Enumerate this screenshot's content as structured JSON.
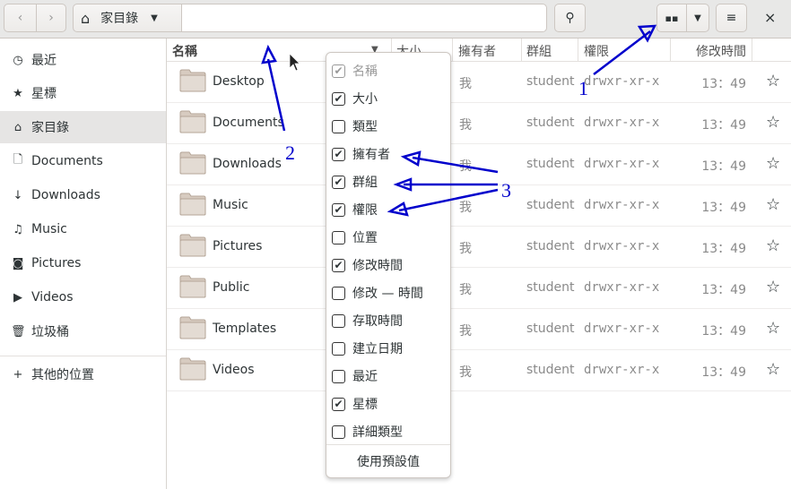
{
  "header": {
    "location": "家目錄",
    "back": "back",
    "forward": "forward"
  },
  "sidebar": {
    "items": [
      {
        "label": "最近",
        "icon": "clock-icon",
        "glyph": "◷"
      },
      {
        "label": "星標",
        "icon": "star-icon",
        "glyph": "★"
      },
      {
        "label": "家目錄",
        "icon": "home-icon",
        "glyph": "⌂",
        "selected": true
      },
      {
        "label": "Documents",
        "icon": "document-icon",
        "glyph": "🗋"
      },
      {
        "label": "Downloads",
        "icon": "download-icon",
        "glyph": "↓"
      },
      {
        "label": "Music",
        "icon": "music-icon",
        "glyph": "♫"
      },
      {
        "label": "Pictures",
        "icon": "camera-icon",
        "glyph": "◙"
      },
      {
        "label": "Videos",
        "icon": "video-icon",
        "glyph": "▶"
      },
      {
        "label": "垃圾桶",
        "icon": "trash-icon",
        "glyph": "🗑"
      },
      {
        "label": "其他的位置",
        "icon": "plus-icon",
        "glyph": "+"
      }
    ]
  },
  "columns": {
    "name": "名稱",
    "size": "大小",
    "owner": "擁有者",
    "group": "群組",
    "permissions": "權限",
    "modified": "修改時間"
  },
  "files": [
    {
      "name": "Desktop",
      "owner": "我",
      "group": "student",
      "permissions": "drwxr-xr-x",
      "modified": "13：49"
    },
    {
      "name": "Documents",
      "owner": "我",
      "group": "student",
      "permissions": "drwxr-xr-x",
      "modified": "13：49"
    },
    {
      "name": "Downloads",
      "owner": "我",
      "group": "student",
      "permissions": "drwxr-xr-x",
      "modified": "13：49"
    },
    {
      "name": "Music",
      "owner": "我",
      "group": "student",
      "permissions": "drwxr-xr-x",
      "modified": "13：49"
    },
    {
      "name": "Pictures",
      "owner": "我",
      "group": "student",
      "permissions": "drwxr-xr-x",
      "modified": "13：49"
    },
    {
      "name": "Public",
      "owner": "我",
      "group": "student",
      "permissions": "drwxr-xr-x",
      "modified": "13：49"
    },
    {
      "name": "Templates",
      "owner": "我",
      "group": "student",
      "permissions": "drwxr-xr-x",
      "modified": "13：49"
    },
    {
      "name": "Videos",
      "owner": "我",
      "group": "student",
      "permissions": "drwxr-xr-x",
      "modified": "13：49"
    }
  ],
  "popover": {
    "items": [
      {
        "label": "名稱",
        "checked": true,
        "disabled": true
      },
      {
        "label": "大小",
        "checked": true
      },
      {
        "label": "類型",
        "checked": false
      },
      {
        "label": "擁有者",
        "checked": true
      },
      {
        "label": "群組",
        "checked": true
      },
      {
        "label": "權限",
        "checked": true
      },
      {
        "label": "位置",
        "checked": false
      },
      {
        "label": "修改時間",
        "checked": true
      },
      {
        "label": "修改 — 時間",
        "checked": false
      },
      {
        "label": "存取時間",
        "checked": false
      },
      {
        "label": "建立日期",
        "checked": false
      },
      {
        "label": "最近",
        "checked": false
      },
      {
        "label": "星標",
        "checked": true
      },
      {
        "label": "詳細類型",
        "checked": false
      }
    ],
    "reset": "使用預設值"
  },
  "annotations": {
    "n1": "1",
    "n2": "2",
    "n3": "3",
    "color": "#0000cc"
  }
}
